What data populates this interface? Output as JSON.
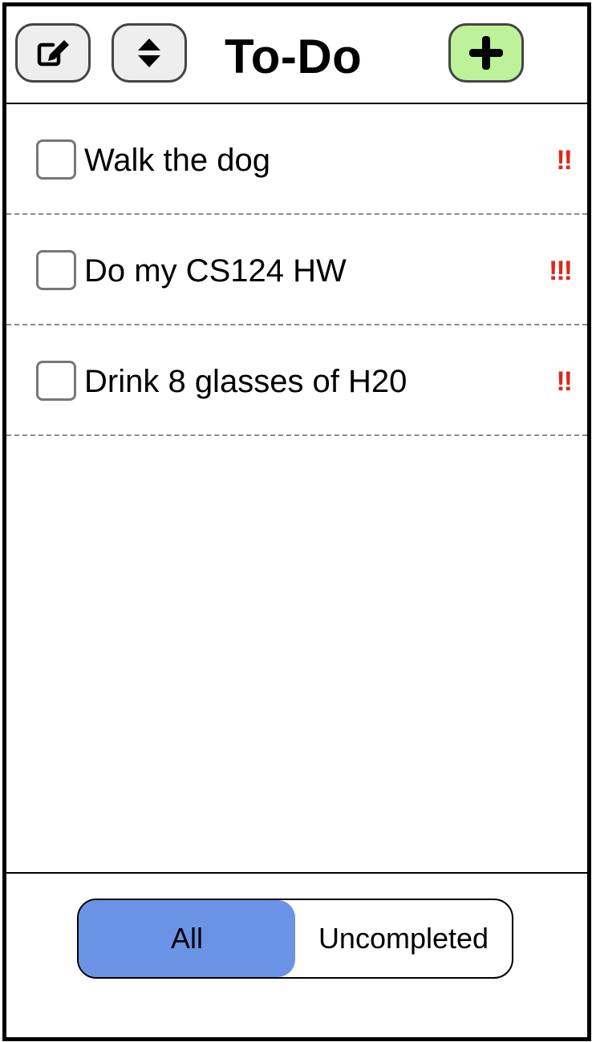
{
  "header": {
    "title": "To-Do",
    "edit_icon": "edit-icon",
    "sort_icon": "sort-icon",
    "add_icon": "plus-icon",
    "add_button_color": "#bdf29a"
  },
  "tasks": [
    {
      "text": "Walk the dog",
      "priority": "!!",
      "completed": false
    },
    {
      "text": "Do my CS124 HW",
      "priority": "!!!",
      "completed": false
    },
    {
      "text": "Drink 8 glasses of H20",
      "priority": "!!",
      "completed": false
    }
  ],
  "filter": {
    "all_label": "All",
    "uncompleted_label": "Uncompleted",
    "selected": "All",
    "active_color": "#6b93e5"
  },
  "colors": {
    "priority": "#e0251c"
  }
}
